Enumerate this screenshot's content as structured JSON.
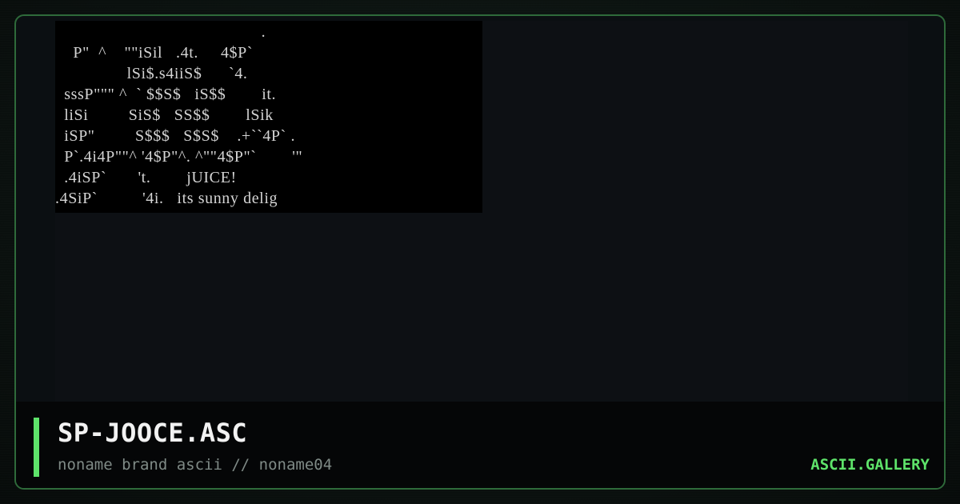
{
  "art": {
    "lines": [
      "                                              .",
      "    P\"  ^    \"\"iSil   .4t.     4$P`",
      "                lSi$.s4iiS$      `4.",
      "  sssP\"\"\" ^  ` $$S$   iS$$        it.",
      "  liSi         SiS$   SS$$        lSik",
      "  iSP\"         S$$$   S$S$    .+``4P` .",
      "  P`.4i4P\"\"^ '4$P\"^. ^\"\"4$P\"`        '\"",
      "  .4iSP`       't.        jUICE!",
      ".4SiP`          '4i.   its sunny delig"
    ]
  },
  "footer": {
    "title": "SP-JOOCE.ASC",
    "subtitle": "noname brand ascii // noname04",
    "brand": "ASCII.GALLERY"
  },
  "colors": {
    "accent": "#5ee36a",
    "frame_border": "#2e6a3a",
    "art_text": "#d4d4d4",
    "art_background": "#000000"
  }
}
